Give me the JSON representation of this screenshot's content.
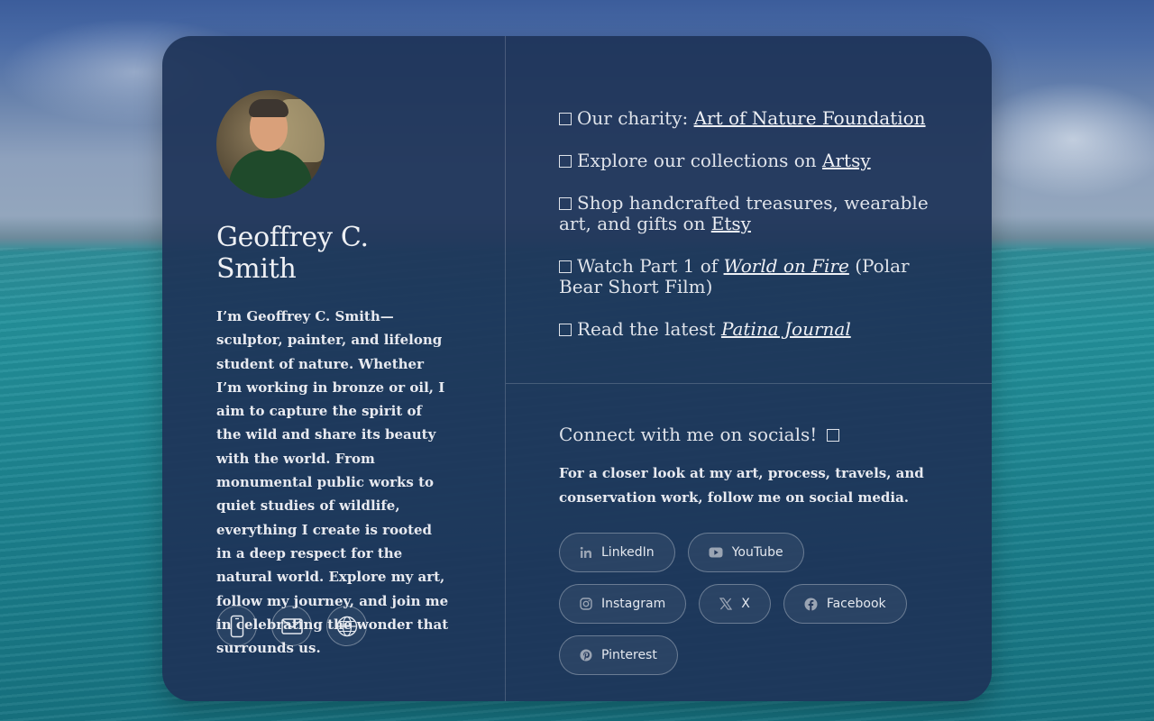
{
  "profile": {
    "name": "Geoffrey C. Smith",
    "bio": "I’m Geoffrey C. Smith—sculptor, painter, and lifelong student of nature. Whether I’m working in bronze or oil, I aim to capture the spirit of the wild and share its beauty with the world. From monumental public works to quiet studies of wildlife, everything I create is rooted in a deep respect for the natural world. Explore my art, follow my journey, and join me in celebrating the wonder that surrounds us.",
    "contact_icons": [
      "phone-icon",
      "email-icon",
      "globe-icon"
    ]
  },
  "links": [
    {
      "prefix": "Our charity: ",
      "link": "Art of Nature Foundation",
      "suffix": ""
    },
    {
      "prefix": "Explore our collections on ",
      "link": "Artsy",
      "suffix": ""
    },
    {
      "prefix": "Shop handcrafted treasures, wearable art, and gifts on ",
      "link": "Etsy",
      "suffix": ""
    },
    {
      "prefix": "Watch Part 1 of ",
      "link": "World on Fire",
      "suffix": " (Polar Bear Short Film)"
    },
    {
      "prefix": "Read the latest ",
      "link": "Patina Journal",
      "suffix": ""
    }
  ],
  "social": {
    "title": "Connect with me on socials!",
    "description": "For a closer look at my art, process, travels, and conservation work, follow me on social media.",
    "buttons": [
      {
        "label": "LinkedIn",
        "icon": "linkedin-icon"
      },
      {
        "label": "YouTube",
        "icon": "youtube-icon"
      },
      {
        "label": "Instagram",
        "icon": "instagram-icon"
      },
      {
        "label": "X",
        "icon": "x-icon"
      },
      {
        "label": "Facebook",
        "icon": "facebook-icon"
      },
      {
        "label": "Pinterest",
        "icon": "pinterest-icon"
      }
    ]
  },
  "colors": {
    "card": "#1e3458",
    "text": "#e6e9f0"
  }
}
